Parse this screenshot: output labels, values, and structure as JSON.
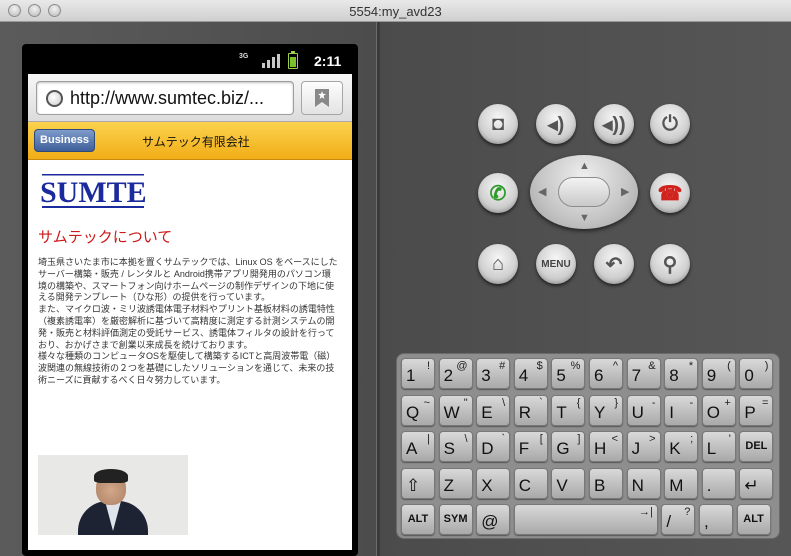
{
  "window": {
    "title": "5554:my_avd23"
  },
  "statusbar": {
    "network": "3G",
    "time": "2:11"
  },
  "browser": {
    "url": "http://www.sumtec.biz/..."
  },
  "site": {
    "business_button": "Business",
    "company_name": "サムテック有限会社",
    "logo_text": "SUMTEC",
    "heading": "サムテックについて",
    "paragraphs": [
      "埼玉県さいたま市に本拠を置くサムテックでは、Linux OS をベースにしたサーバー構築・販売 / レンタルと Android携帯アプリ開発用のパソコン環境の構築や、スマートフォン向けホームページの制作デザインの下地に使える開発テンプレート（ひな形）の提供を行っています。",
      "また、マイクロ波・ミリ波誘電体電子材料やプリント基板材料の誘電特性（複素誘電率）を厳密解析に基づいて高精度に測定する計測システムの開発・販売と材料評価測定の受託サービス、誘電体フィルタの設計を行っており、おかげさまで創業以来成長を続けております。",
      "様々な種類のコンピュータOSを駆使して構築するICTと高周波帯電（磁）波関連の無線技術の２つを基礎にしたソリューションを通じて、未来の技術ニーズに貢献するべく日々努力しています。"
    ]
  },
  "controls": {
    "menu_label": "MENU"
  },
  "keyboard": {
    "rows": [
      [
        {
          "m": "1",
          "s": "!"
        },
        {
          "m": "2",
          "s": "@"
        },
        {
          "m": "3",
          "s": "#"
        },
        {
          "m": "4",
          "s": "$"
        },
        {
          "m": "5",
          "s": "%"
        },
        {
          "m": "6",
          "s": "^"
        },
        {
          "m": "7",
          "s": "&"
        },
        {
          "m": "8",
          "s": "*"
        },
        {
          "m": "9",
          "s": "("
        },
        {
          "m": "0",
          "s": ")"
        }
      ],
      [
        {
          "m": "Q",
          "s": "~"
        },
        {
          "m": "W",
          "s": "\""
        },
        {
          "m": "E",
          "s": "\\"
        },
        {
          "m": "R",
          "s": "`"
        },
        {
          "m": "T",
          "s": "{"
        },
        {
          "m": "Y",
          "s": "}"
        },
        {
          "m": "U",
          "s": "-"
        },
        {
          "m": "I",
          "s": "-"
        },
        {
          "m": "O",
          "s": "+"
        },
        {
          "m": "P",
          "s": "="
        }
      ],
      [
        {
          "m": "A",
          "s": "|"
        },
        {
          "m": "S",
          "s": "\\"
        },
        {
          "m": "D",
          "s": "`"
        },
        {
          "m": "F",
          "s": "["
        },
        {
          "m": "G",
          "s": "]"
        },
        {
          "m": "H",
          "s": "<"
        },
        {
          "m": "J",
          "s": ">"
        },
        {
          "m": "K",
          "s": ";"
        },
        {
          "m": "L",
          "s": "'"
        },
        {
          "m": "DEL",
          "s": ""
        }
      ],
      [
        {
          "m": "⇧",
          "s": ""
        },
        {
          "m": "Z",
          "s": ""
        },
        {
          "m": "X",
          "s": ""
        },
        {
          "m": "C",
          "s": ""
        },
        {
          "m": "V",
          "s": ""
        },
        {
          "m": "B",
          "s": ""
        },
        {
          "m": "N",
          "s": ""
        },
        {
          "m": "M",
          "s": ""
        },
        {
          "m": ".",
          "s": ""
        },
        {
          "m": "↵",
          "s": ""
        }
      ],
      [
        {
          "m": "ALT",
          "s": ""
        },
        {
          "m": "SYM",
          "s": ""
        },
        {
          "m": "@",
          "s": ""
        },
        {
          "m": "",
          "s": "→|"
        },
        {
          "m": "/",
          "s": "?"
        },
        {
          "m": ",",
          "s": ""
        },
        {
          "m": "ALT",
          "s": ""
        }
      ]
    ]
  }
}
